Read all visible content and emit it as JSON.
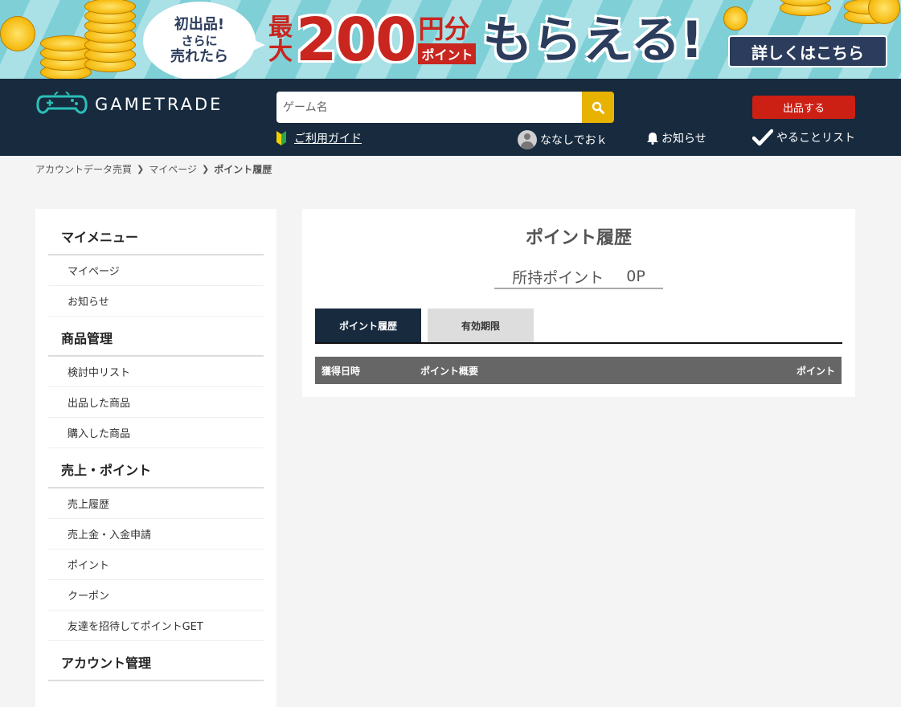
{
  "banner": {
    "bubble_line1": "初出品!",
    "bubble_line2": "さらに",
    "bubble_line3": "売れたら",
    "saidai_1": "最",
    "saidai_2": "大",
    "amount": "200",
    "yen_bun": "円分",
    "point_label": "ポイント",
    "morau": "もらえる!",
    "detail_label": "詳しくはこちら"
  },
  "header": {
    "logo_text": "GAMETRADE",
    "search_placeholder": "ゲーム名",
    "guide_label": "ご利用ガイド",
    "sell_label": "出品する",
    "user_name": "ななしでおｋ",
    "notice_label": "お知らせ",
    "todo_label": "やることリスト"
  },
  "breadcrumb": {
    "items": [
      "アカウントデータ売買",
      "マイページ",
      "ポイント履歴"
    ]
  },
  "sidebar": {
    "sections": [
      {
        "title": "マイメニュー",
        "items": [
          "マイページ",
          "お知らせ"
        ]
      },
      {
        "title": "商品管理",
        "items": [
          "検討中リスト",
          "出品した商品",
          "購入した商品"
        ]
      },
      {
        "title": "売上・ポイント",
        "items": [
          "売上履歴",
          "売上金・入金申請",
          "ポイント",
          "クーポン",
          "友達を招待してポイントGET"
        ]
      },
      {
        "title": "アカウント管理",
        "items": []
      }
    ]
  },
  "main": {
    "title": "ポイント履歴",
    "points_label": "所持ポイント",
    "points_value": "0P",
    "tabs": [
      {
        "label": "ポイント履歴",
        "active": true
      },
      {
        "label": "有効期限",
        "active": false
      }
    ],
    "table": {
      "headers": [
        "獲得日時",
        "ポイント概要",
        "ポイント"
      ]
    }
  },
  "colors": {
    "header_bg": "#172a3e",
    "accent_red": "#cc2015",
    "search_btn": "#e7b200",
    "table_head": "#666666"
  }
}
